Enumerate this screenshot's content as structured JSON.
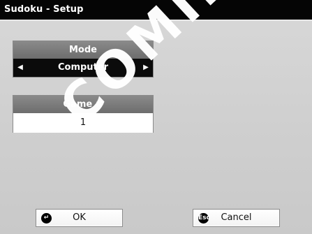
{
  "window": {
    "title": "Sudoku - Setup",
    "watermark": "COMING"
  },
  "mode_panel": {
    "label": "Mode",
    "value": "Computer",
    "left_arrow": "◀",
    "right_arrow": "▶"
  },
  "game_panel": {
    "label": "Game #",
    "value": "1"
  },
  "buttons": {
    "ok": {
      "label": "OK",
      "icon": "↵",
      "icon_name": "enter-icon"
    },
    "cancel": {
      "label": "Cancel",
      "icon": "Esc",
      "icon_name": "escape-icon"
    }
  }
}
